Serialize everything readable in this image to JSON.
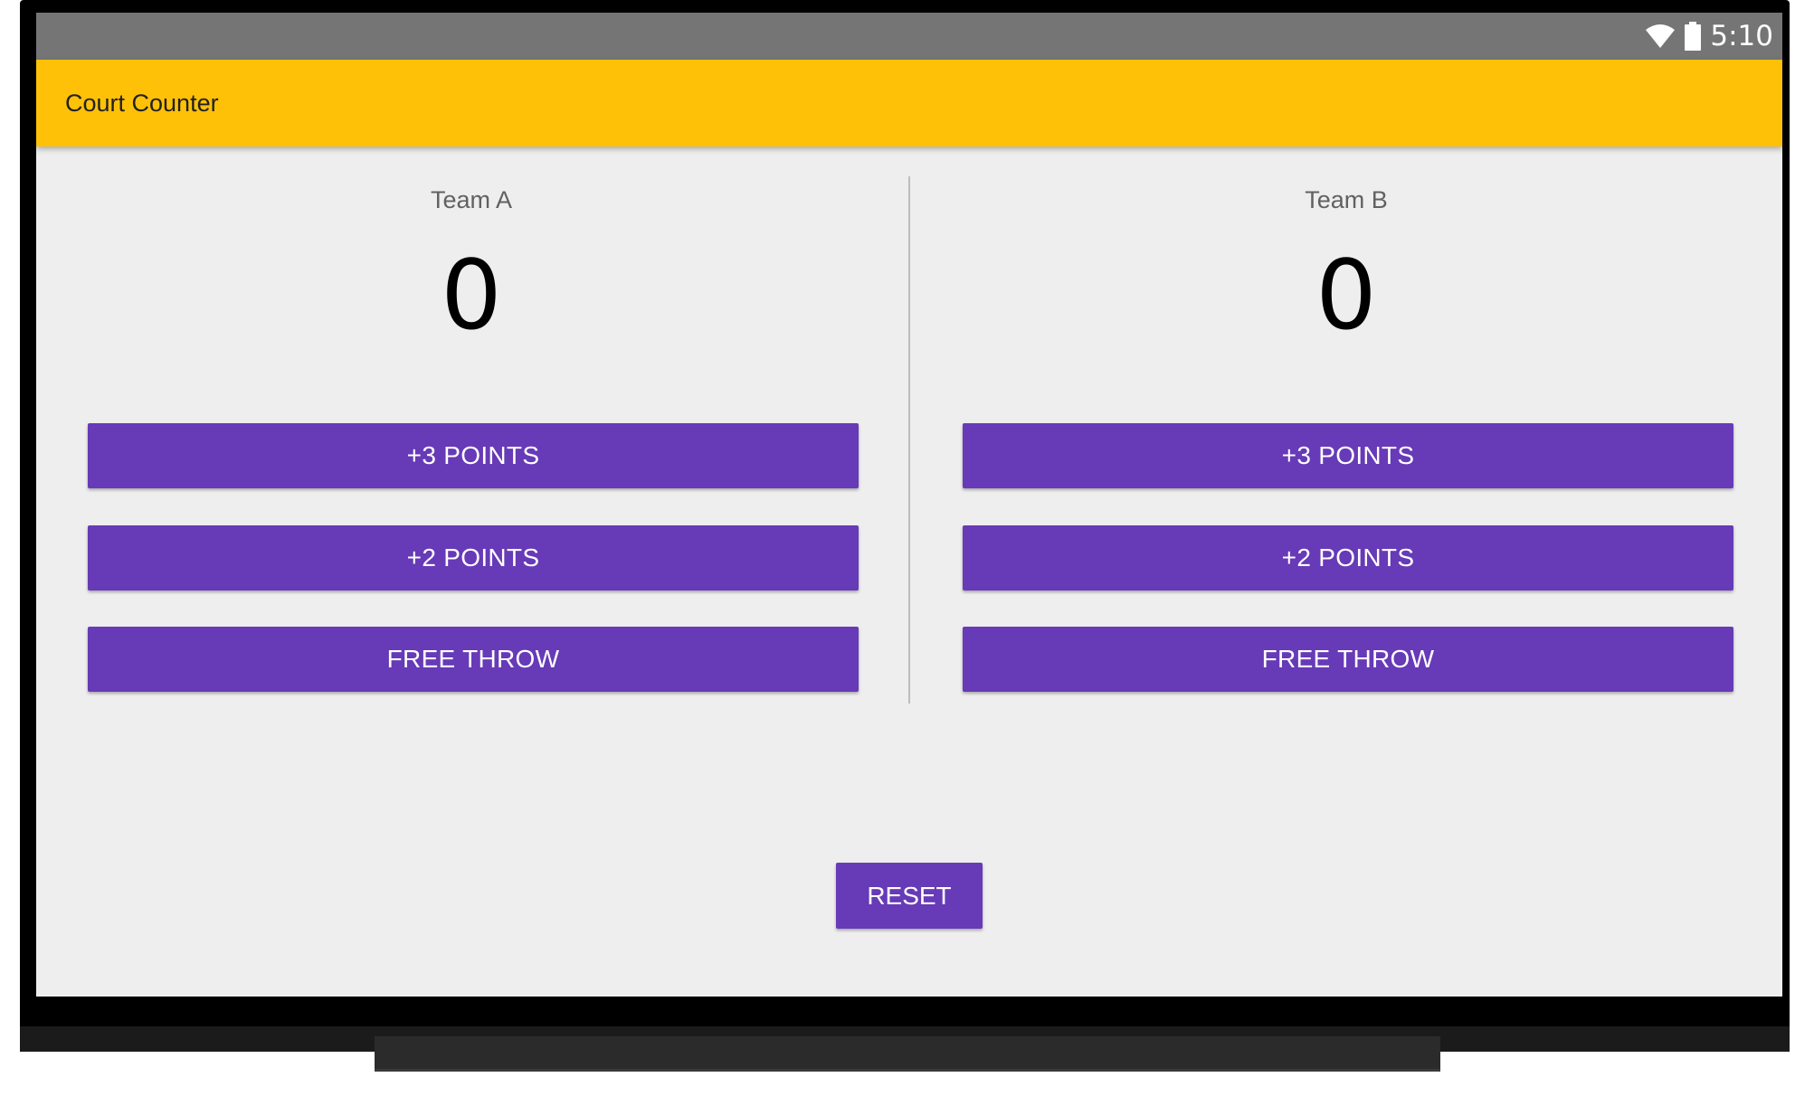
{
  "status_bar": {
    "time": "5:10",
    "icons": [
      "wifi-icon",
      "battery-icon"
    ],
    "background": "#757575"
  },
  "app_bar": {
    "title": "Court Counter",
    "background": "#ffc107"
  },
  "teams": [
    {
      "name": "Team A",
      "score": "0",
      "buttons": {
        "three": "+3 POINTS",
        "two": "+2 POINTS",
        "free_throw": "FREE THROW"
      }
    },
    {
      "name": "Team B",
      "score": "0",
      "buttons": {
        "three": "+3 POINTS",
        "two": "+2 POINTS",
        "free_throw": "FREE THROW"
      }
    }
  ],
  "reset_label": "RESET",
  "colors": {
    "accent": "#673ab7",
    "primary": "#ffc107",
    "background": "#eeeeee"
  }
}
